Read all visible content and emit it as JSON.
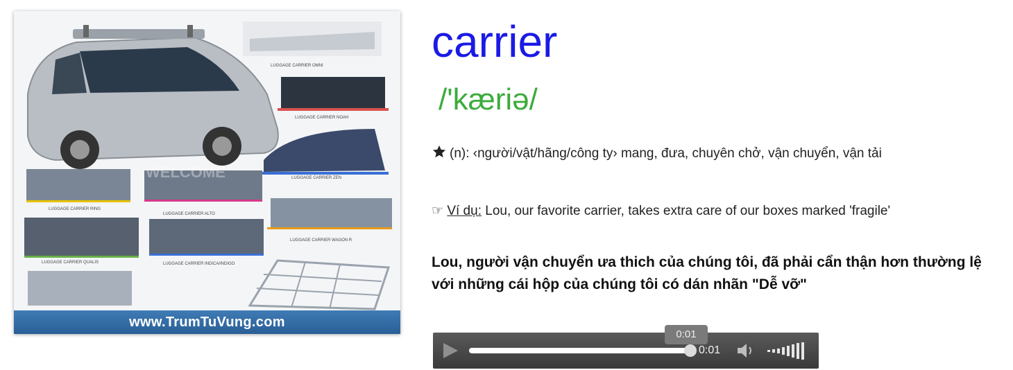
{
  "image": {
    "footer_text": "www.TrumTuVung.com",
    "watermark_text": "WELCOME",
    "product_labels": [
      "LUGGAGE CARRIER OMNI",
      "LUGGAGE CARRIER NOAH",
      "LUGGAGE CARRIER ZEN",
      "LUGGAGE CARRIER RING",
      "LUGGAGE CARRIER ALTO",
      "LUGGAGE CARRIER WAGON R",
      "LUGGAGE CARRIER QUALIS",
      "LUGGAGE CARRIER INDICA/INDIGO"
    ]
  },
  "entry": {
    "word": "carrier",
    "pronunciation": "/'kæriə/",
    "definition": "(n): ‹người/vật/hãng/công ty› mang, đưa, chuyên chở, vận chuyển, vận tải",
    "example_label": "Ví dụ:",
    "example_text": " Lou, our favorite carrier, takes extra care of our boxes marked 'fragile'",
    "translation": "Lou, người vận chuyển ưa thich của chúng tôi, đã phải cẩn thận hơn thường lệ với những cái hộp của chúng tôi có dán nhãn \"Dễ vỡ\""
  },
  "player": {
    "current_time": "0:01",
    "tooltip_time": "0:01",
    "progress": 1.0
  },
  "colors": {
    "word": "#1a1ae6",
    "pronunciation": "#3cab3c",
    "player_bg": "#4a4a4a",
    "footer_bg": "#2f6aa6"
  },
  "icons": {
    "definition": "star-icon",
    "example": "pointing-hand-icon",
    "play": "play-icon",
    "volume": "speaker-icon"
  }
}
